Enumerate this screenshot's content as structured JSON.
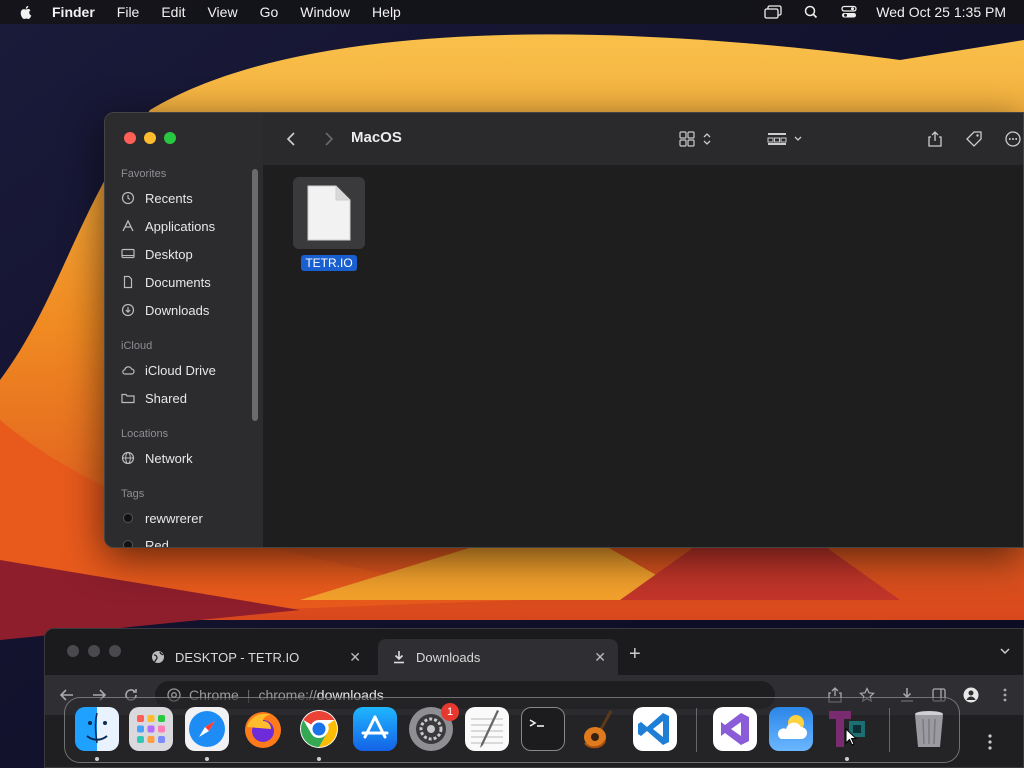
{
  "menubar": {
    "app_name": "Finder",
    "menus": [
      "File",
      "Edit",
      "View",
      "Go",
      "Window",
      "Help"
    ],
    "clock": "Wed Oct 25  1:35 PM"
  },
  "finder": {
    "title": "MacOS",
    "sidebar": {
      "favorites_label": "Favorites",
      "favorites": [
        "Recents",
        "Applications",
        "Desktop",
        "Documents",
        "Downloads"
      ],
      "icloud_label": "iCloud",
      "icloud": [
        "iCloud Drive",
        "Shared"
      ],
      "locations_label": "Locations",
      "locations": [
        "Network"
      ],
      "tags_label": "Tags",
      "tags": [
        "rewwrerer",
        "Red"
      ]
    },
    "files": [
      {
        "name": "TETR.IO",
        "selected": true
      }
    ]
  },
  "chrome": {
    "tabs": [
      {
        "label": "DESKTOP - TETR.IO",
        "active": false
      },
      {
        "label": "Downloads",
        "active": true
      }
    ],
    "omnibox": {
      "scheme_label": "Chrome",
      "url_prefix": "chrome://",
      "url_path": "downloads"
    }
  },
  "dock": {
    "apps": [
      "Finder",
      "Launchpad",
      "Safari",
      "Firefox",
      "Chrome",
      "App Store",
      "System Settings",
      "TextEdit",
      "Terminal",
      "GarageBand",
      "Visual Studio Code",
      "Visual Studio",
      "Weather",
      "TETR.IO",
      "Trash"
    ],
    "system_settings_badge": "1"
  },
  "colors": {
    "accent": "#1a5fd0",
    "badge": "#e6382f"
  }
}
